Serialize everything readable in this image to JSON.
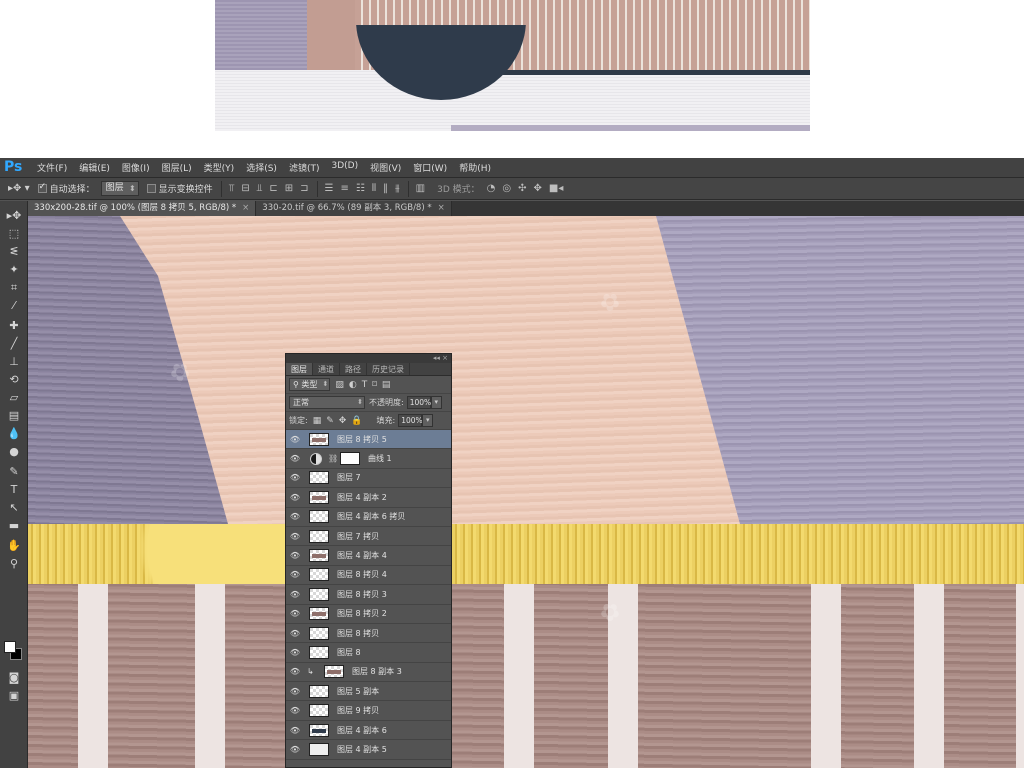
{
  "app": {
    "logo": "Ps"
  },
  "menu": [
    "文件(F)",
    "编辑(E)",
    "图像(I)",
    "图层(L)",
    "类型(Y)",
    "选择(S)",
    "滤镜(T)",
    "3D(D)",
    "视图(V)",
    "窗口(W)",
    "帮助(H)"
  ],
  "options_bar": {
    "auto_select_label": "自动选择：",
    "auto_select_checked": true,
    "auto_select_target": "图层",
    "show_transform_label": "显示变换控件",
    "show_transform_checked": false,
    "mode_3d_label": "3D 模式："
  },
  "tabs": [
    {
      "label": "330x200-28.tif @ 100% (图层 8 拷贝 5, RGB/8) *",
      "active": true
    },
    {
      "label": "330-20.tif @ 66.7% (89 副本 3, RGB/8) *",
      "active": false
    }
  ],
  "layers_panel": {
    "tabs": [
      "图层",
      "通道",
      "路径",
      "历史记录"
    ],
    "active_tab": "图层",
    "filter_kind": "类型",
    "blend_mode": "正常",
    "opacity_label": "不透明度:",
    "opacity_value": "100%",
    "lock_label": "锁定:",
    "fill_label": "填充:",
    "fill_value": "100%",
    "layers": [
      {
        "name": "图层 8 拷贝 5",
        "selected": true,
        "kind": "pixel"
      },
      {
        "name": "曲线 1",
        "selected": false,
        "kind": "adjustment"
      },
      {
        "name": "图层 7",
        "selected": false,
        "kind": "pixel"
      },
      {
        "name": "图层 4 副本 2",
        "selected": false,
        "kind": "pixel"
      },
      {
        "name": "图层 4 副本 6 拷贝",
        "selected": false,
        "kind": "pixel"
      },
      {
        "name": "图层 7 拷贝",
        "selected": false,
        "kind": "pixel"
      },
      {
        "name": "图层 4 副本 4",
        "selected": false,
        "kind": "pixel"
      },
      {
        "name": "图层 8 拷贝 4",
        "selected": false,
        "kind": "pixel"
      },
      {
        "name": "图层 8 拷贝 3",
        "selected": false,
        "kind": "pixel"
      },
      {
        "name": "图层 8 拷贝 2",
        "selected": false,
        "kind": "pixel"
      },
      {
        "name": "图层 8 拷贝",
        "selected": false,
        "kind": "pixel"
      },
      {
        "name": "图层 8",
        "selected": false,
        "kind": "pixel"
      },
      {
        "name": "图层 8 副本 3",
        "selected": false,
        "kind": "clipped"
      },
      {
        "name": "图层 5 副本",
        "selected": false,
        "kind": "pixel"
      },
      {
        "name": "图层 9 拷贝",
        "selected": false,
        "kind": "pixel"
      },
      {
        "name": "图层 4 副本 6",
        "selected": false,
        "kind": "dark"
      },
      {
        "name": "图层 4 副本 5",
        "selected": false,
        "kind": "white"
      }
    ]
  },
  "colors": {
    "ps_logo": "#31a8ff",
    "foreground": "#ffffff",
    "background": "#000000",
    "selected_layer": "#6c7d95"
  },
  "icons": {
    "visibility": "eye-icon",
    "move_tool": "move-tool-icon",
    "adjustment": "curves-adjustment-icon"
  }
}
